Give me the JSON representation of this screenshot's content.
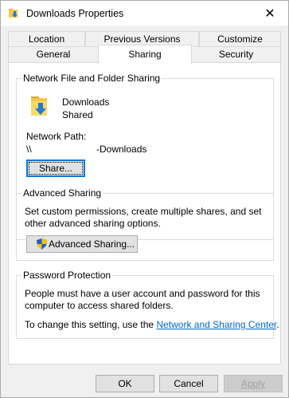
{
  "window": {
    "title": "Downloads Properties",
    "close_glyph": "✕"
  },
  "tabs": {
    "location": "Location",
    "previous_versions": "Previous Versions",
    "customize": "Customize",
    "general": "General",
    "sharing": "Sharing",
    "security": "Security"
  },
  "network_sharing": {
    "title": "Network File and Folder Sharing",
    "folder_name": "Downloads",
    "folder_status": "Shared",
    "network_path_label": "Network Path:",
    "network_path_prefix": "\\\\",
    "network_path_suffix": "-Downloads",
    "share_button": "Share..."
  },
  "advanced_sharing": {
    "title": "Advanced Sharing",
    "description": "Set custom permissions, create multiple shares, and set other advanced sharing options.",
    "button": "Advanced Sharing..."
  },
  "password_protection": {
    "title": "Password Protection",
    "description": "People must have a user account and password for this computer to access shared folders.",
    "change_text": "To change this setting, use the",
    "link": "Network and Sharing Center",
    "period": "."
  },
  "footer": {
    "ok": "OK",
    "cancel": "Cancel",
    "apply": "Apply"
  },
  "colors": {
    "accent": "#0078d7",
    "link": "#0066cc",
    "folder": "#f7c948",
    "arrow": "#1e7bd6"
  },
  "icons": {
    "title": "folder-download-icon",
    "folder": "folder-download-icon",
    "shield": "uac-shield-icon"
  }
}
